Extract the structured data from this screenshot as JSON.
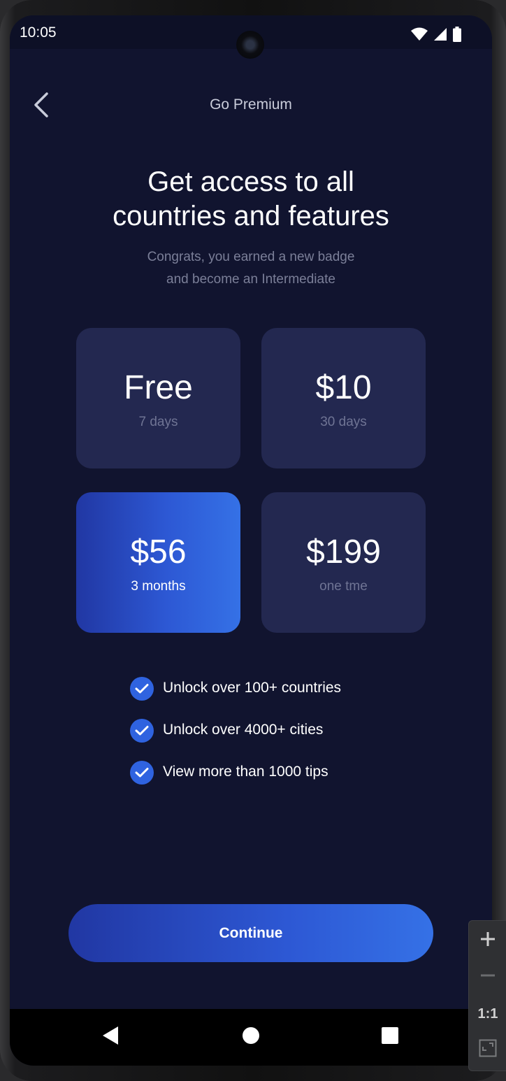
{
  "status_bar": {
    "time": "10:05"
  },
  "header": {
    "title": "Go Premium"
  },
  "headline": {
    "line1": "Get access to all",
    "line2": "countries and features"
  },
  "subtitle": {
    "line1": "Congrats, you earned a new badge",
    "line2": "and become an Intermediate"
  },
  "plans": [
    {
      "price": "Free",
      "period": "7 days",
      "selected": false
    },
    {
      "price": "$10",
      "period": "30 days",
      "selected": false
    },
    {
      "price": "$56",
      "period": "3 months",
      "selected": true
    },
    {
      "price": "$199",
      "period": "one tme",
      "selected": false
    }
  ],
  "features": [
    "Unlock over 100+ countries",
    "Unlock over 4000+ cities",
    "View more than 1000 tips"
  ],
  "continue_label": "Continue",
  "zoom_controls": {
    "reset_label": "1:1"
  },
  "colors": {
    "background": "#11142f",
    "card": "#232850",
    "accent": "#2f63e0"
  }
}
